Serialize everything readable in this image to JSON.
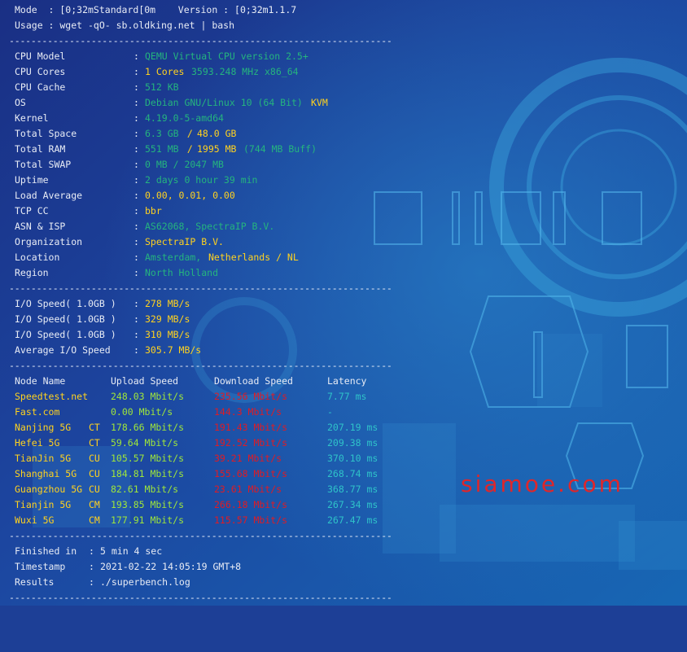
{
  "header": {
    "mode_label": "Mode  : [0;32mStandard[0m    Version : [0;32m1.1.7",
    "usage_label": "Usage : wget -qO- sb.oldking.net | bash"
  },
  "separator": "----------------------------------------------------------------------",
  "sysinfo": {
    "cpu_model_label": "CPU Model",
    "cpu_model": "QEMU Virtual CPU version 2.5+",
    "cpu_cores_label": "CPU Cores",
    "cpu_cores_count": "1 Cores",
    "cpu_cores_freq": "3593.248 MHz x86_64",
    "cpu_cache_label": "CPU Cache",
    "cpu_cache": "512 KB",
    "os_label": "OS",
    "os": "Debian GNU/Linux 10 (64 Bit)",
    "os_virt": "KVM",
    "kernel_label": "Kernel",
    "kernel": "4.19.0-5-amd64",
    "space_label": "Total Space",
    "space_used": "6.3 GB",
    "space_sep": " / ",
    "space_total": "48.0 GB",
    "ram_label": "Total RAM",
    "ram_used": "551 MB",
    "ram_sep": " / ",
    "ram_total": "1995 MB",
    "ram_buff": "(744 MB Buff)",
    "swap_label": "Total SWAP",
    "swap": "0 MB / 2047 MB",
    "uptime_label": "Uptime",
    "uptime": "2 days 0 hour 39 min",
    "load_label": "Load Average",
    "load": "0.00, 0.01, 0.00",
    "tcp_label": "TCP CC",
    "tcp": "bbr",
    "asn_label": "ASN & ISP",
    "asn": "AS62068, SpectraIP B.V.",
    "org_label": "Organization",
    "org": "SpectraIP B.V.",
    "loc_label": "Location",
    "loc_city": "Amsterdam,",
    "loc_country": "Netherlands / NL",
    "region_label": "Region",
    "region": "North Holland"
  },
  "io": {
    "run1_label": "I/O Speed( 1.0GB )",
    "run1": "278 MB/s",
    "run2_label": "I/O Speed( 1.0GB )",
    "run2": "329 MB/s",
    "run3_label": "I/O Speed( 1.0GB )",
    "run3": "310 MB/s",
    "avg_label": "Average I/O Speed",
    "avg": "305.7 MB/s"
  },
  "speedtest": {
    "headers": {
      "node": "Node Name",
      "upload": "Upload Speed",
      "download": "Download Speed",
      "latency": "Latency"
    },
    "rows": [
      {
        "node": "Speedtest.net",
        "isp": "",
        "upload": "248.03 Mbit/s",
        "download": "235.56 Mbit/s",
        "latency": "7.77 ms"
      },
      {
        "node": "Fast.com",
        "isp": "",
        "upload": "0.00 Mbit/s",
        "download": "144.3 Mbit/s",
        "latency": "-"
      },
      {
        "node": "Nanjing 5G",
        "isp": "CT",
        "upload": "178.66 Mbit/s",
        "download": "191.43 Mbit/s",
        "latency": "207.19 ms"
      },
      {
        "node": "Hefei 5G",
        "isp": "CT",
        "upload": "59.64 Mbit/s",
        "download": "192.52 Mbit/s",
        "latency": "209.38 ms"
      },
      {
        "node": "TianJin 5G",
        "isp": "CU",
        "upload": "105.57 Mbit/s",
        "download": "39.21 Mbit/s",
        "latency": "370.10 ms"
      },
      {
        "node": "Shanghai 5G",
        "isp": "CU",
        "upload": "184.81 Mbit/s",
        "download": "155.68 Mbit/s",
        "latency": "268.74 ms"
      },
      {
        "node": "Guangzhou 5G",
        "isp": "CU",
        "upload": "82.61 Mbit/s",
        "download": "23.61 Mbit/s",
        "latency": "368.77 ms"
      },
      {
        "node": "Tianjin 5G",
        "isp": "CM",
        "upload": "193.85 Mbit/s",
        "download": "266.18 Mbit/s",
        "latency": "267.34 ms"
      },
      {
        "node": "Wuxi 5G",
        "isp": "CM",
        "upload": "177.91 Mbit/s",
        "download": "115.57 Mbit/s",
        "latency": "267.47 ms"
      }
    ]
  },
  "footer": {
    "finished_label": "Finished in",
    "finished": "5 min 4 sec",
    "timestamp_label": "Timestamp",
    "timestamp": "2021-02-22 14:05:19 GMT+8",
    "results_label": "Results",
    "results": "./superbench.log"
  },
  "watermark": "siamoe.com",
  "colors": {
    "background": "#1d3f96",
    "text": "#e8ecf5",
    "green": "#25b47e",
    "yellow": "#ffd21f",
    "light_green": "#9fe63a",
    "red": "#e01b24",
    "cyan": "#2fc3c9",
    "watermark": "#e0262a"
  }
}
